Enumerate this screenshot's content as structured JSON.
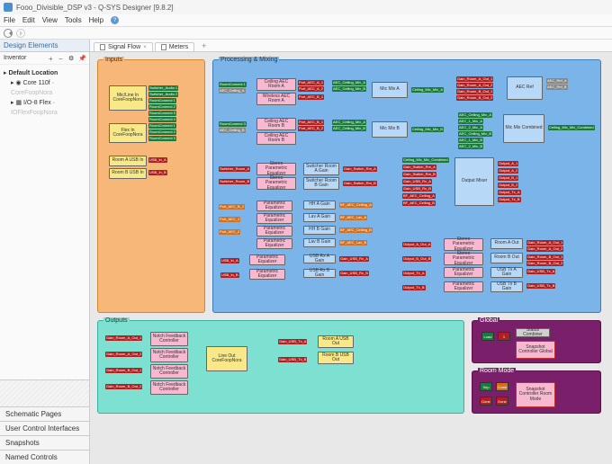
{
  "app": {
    "title": "Fooo_Divisible_DSP v3 - Q-SYS Designer [9.8.2]",
    "menu": [
      "File",
      "Edit",
      "View",
      "Tools",
      "Help"
    ]
  },
  "sidebar": {
    "header": "Design Elements",
    "section": "Inventor",
    "node0": "Default Location",
    "node1": "Core 110f",
    "node2": "I/O-8 Flex"
  },
  "strips": {
    "s1": "Schematic Pages",
    "s2": "User Control Interfaces",
    "s3": "Snapshots",
    "s4": "Named Controls"
  },
  "tabs": {
    "t1": "Signal Flow",
    "t2": "Meters"
  },
  "groups": {
    "inputs": "Inputs",
    "processing": "Processing & Mixing",
    "outputs": "Outputs",
    "global": "Global",
    "roommode": "Room Mode"
  },
  "blocks": {
    "micline": "Mic/Line In\nCoreFoopNora",
    "flexin": "Flex In\nCoreFoopNora",
    "roomausb": "Room A USB In",
    "roombusb": "Room B USB In",
    "ceilaec_a": "Ceiling AEC Room A",
    "wiraec_a": "Wireless AEC Room A",
    "ceilaec_b": "Ceiling AEC Room B",
    "wiraec_b": "Ceiling AEC Room B",
    "micmix_a": "Mic Mix A",
    "micmix_b": "Mic Mix B",
    "micmix_c": "Mic Mix Combined",
    "aecref": "AEC Ref",
    "speq_a": "Stereo Parametric Equalizer",
    "speq_b": "Stereo Parametric Equalizer",
    "speq_c": "Stereo Parametric Equalizer",
    "speq_d": "Stereo Parametric Equalizer",
    "peq": "Parametric Equalizer",
    "swgain_a": "Switcher Room A Gain",
    "swgain_b": "Switcher Room B Gain",
    "hhagain": "HH A Gain",
    "lavagain": "Lav A Gain",
    "hhbgain": "HH B Gain",
    "lavbgain": "Lav B Gain",
    "usbra": "USB Rx A Gain",
    "usbrb": "USB Rx B Gain",
    "outmix": "Output Mixer",
    "ra_out": "Room A Out",
    "rb_out": "Room B Out",
    "usba_out": "USB Tx A Gain",
    "usbb_out": "USB Tx B Gain",
    "notch": "Notch Feedback Controller",
    "lineout": "Line Out\nCoreFoopNora",
    "rausbout": "Room A USB Out",
    "rbusbout": "Room B USB Out",
    "status_a": "Status Combiner",
    "snap_g": "Snapshot Controller Global",
    "snap_r": "Snapshot Controller Room Mode",
    "load": "Load",
    "sep": "Sep",
    "comb": "Comb",
    "done": "Done"
  },
  "tags": {
    "sw_a1": "Switcher_Audio 1",
    "sw_a2": "Switcher_Audio 2",
    "rc1": "RoomConnect 1",
    "rc2": "RoomConnect 2",
    "rc3": "RoomConnect 3",
    "rc4": "RoomConnect 4",
    "aec_cmixa": "AEC_Ceiling_Mix_A",
    "aec_cmixb": "AEC_Ceiling_Mix_B",
    "cmic_mixa": "Ceiling_Mic_Mix_A",
    "cmic_mixb": "Ceiling_Mic_Mix_B",
    "cmic_mixc": "Ceiling_Mic_Mix_Combined",
    "usbin_a": "USB_In_A",
    "usbin_b": "USB_In_B",
    "port_aec_a1": "Port_AEC_A_1",
    "port_aec_a2": "Port_AEC_A_2",
    "port_aec_b1": "Port_AEC_B_1",
    "aec_cla": "AEC_Ceiling_A",
    "sw_ra": "Switcher_Room_A",
    "sw_rb": "Switcher_Room_B",
    "g_sw_ra": "Gain_Switch_Rm_A",
    "g_sw_rb": "Gain_Switch_Rm_B",
    "g_aec_a": "BF_AEC_Ceiling_A",
    "g_aec_b": "BF_AEC_Ceiling_B",
    "g_usb_rxa": "Gain_USB_Rx_A",
    "g_usb_rxb": "Gain_USB_Rx_B",
    "g_ra_1": "Gain_Room_A_Out_1",
    "g_ra_2": "Gain_Room_A_Out_2",
    "g_rb_1": "Gain_Room_B_Out_1",
    "g_rb_2": "Gain_Room_B_Out_2",
    "g_usb_txa": "Gain_USB_Tx_A",
    "g_usb_txb": "Gain_USB_Tx_B"
  }
}
